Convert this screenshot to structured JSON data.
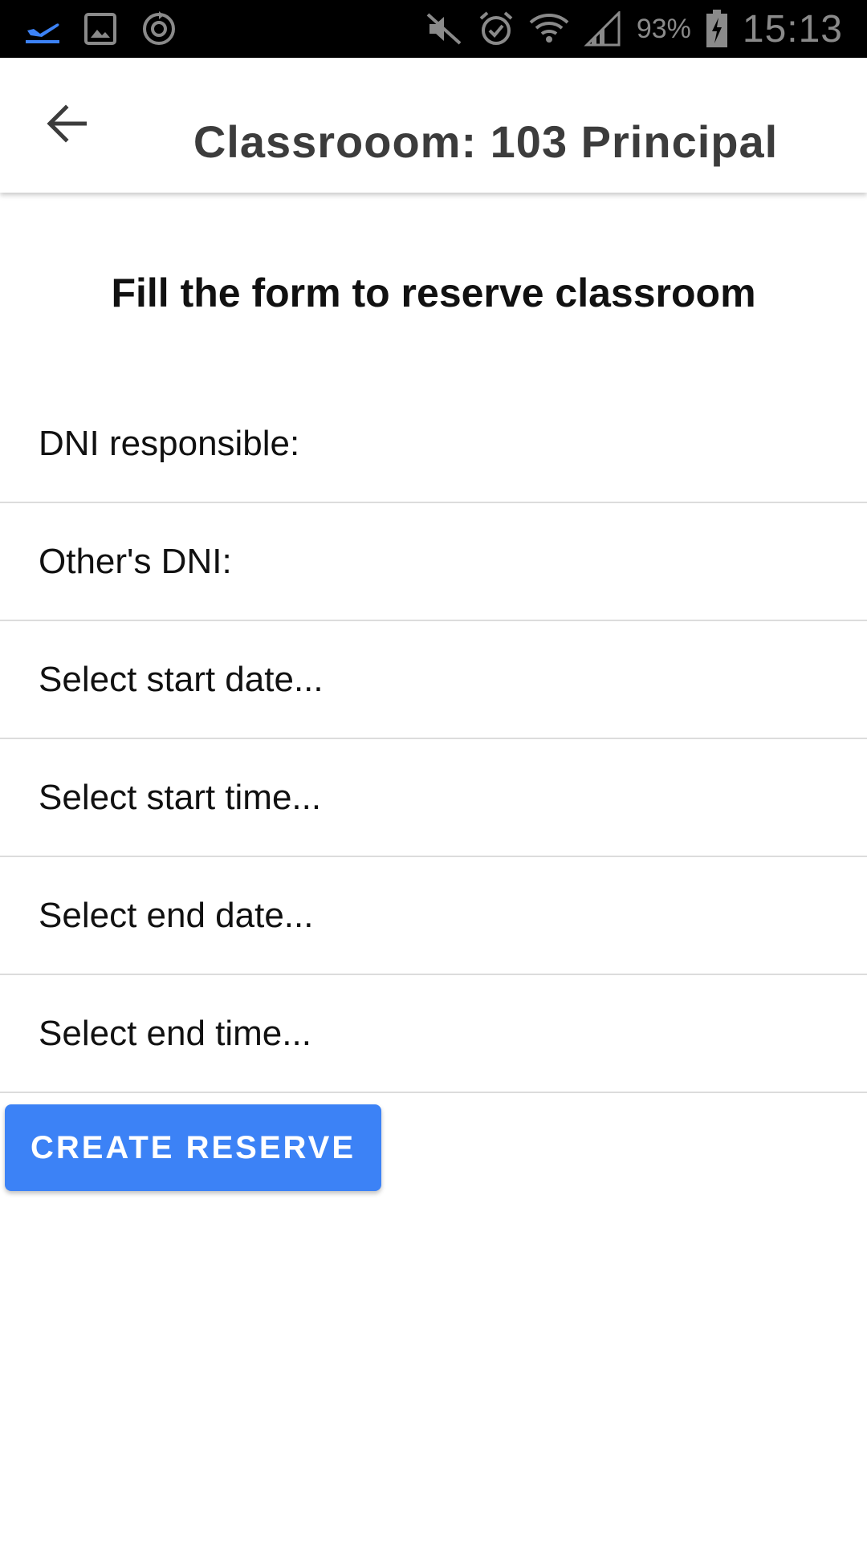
{
  "status_bar": {
    "battery_percent": "93%",
    "time": "15:13",
    "icons_left": [
      "airplane-departure-icon",
      "image-icon",
      "sync-icon"
    ],
    "icons_right": [
      "muted-icon",
      "alarm-icon",
      "wifi-icon",
      "signal-icon",
      "battery-charging-icon"
    ],
    "accent_color": "#3c82f6"
  },
  "appbar": {
    "title": "Classrooom: 103 Principal",
    "back_icon": "arrow-back-icon"
  },
  "form": {
    "heading": "Fill the form to reserve classroom",
    "fields": [
      {
        "label": "DNI responsible:"
      },
      {
        "label": "Other's DNI:"
      },
      {
        "label": "Select start date..."
      },
      {
        "label": "Select start time..."
      },
      {
        "label": "Select end date..."
      },
      {
        "label": "Select end time..."
      }
    ],
    "submit_label": "CREATE RESERVE",
    "submit_color": "#3c82f6"
  }
}
